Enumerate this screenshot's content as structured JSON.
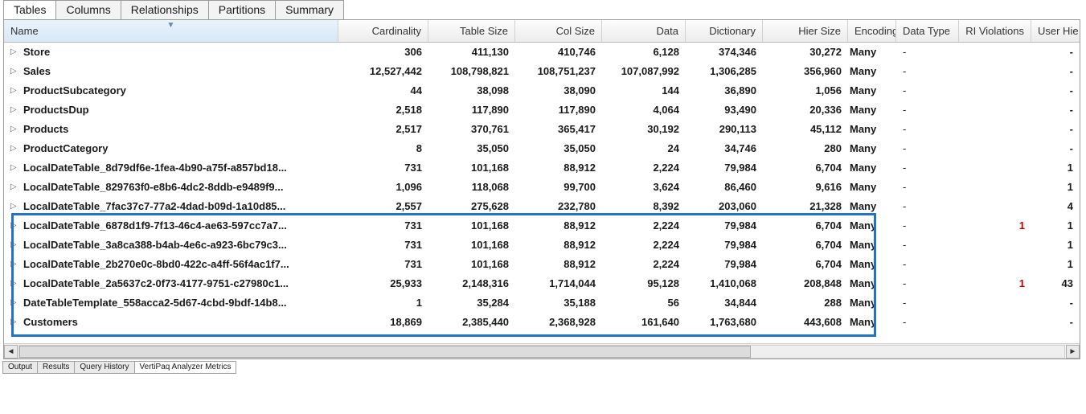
{
  "top_tabs": [
    "Tables",
    "Columns",
    "Relationships",
    "Partitions",
    "Summary"
  ],
  "top_tab_active": 0,
  "columns": {
    "name": "Name",
    "cardinality": "Cardinality",
    "table_size": "Table Size",
    "col_size": "Col Size",
    "data": "Data",
    "dictionary": "Dictionary",
    "hier_size": "Hier Size",
    "encoding": "Encoding",
    "data_type": "Data Type",
    "ri": "RI Violations",
    "user_hier": "User Hie"
  },
  "rows": [
    {
      "name": "Store",
      "card": "306",
      "tsize": "411,130",
      "csize": "410,746",
      "data": "6,128",
      "dict": "374,346",
      "hier": "30,272",
      "enc": "Many",
      "dt": "-",
      "ri": "",
      "uh": "-"
    },
    {
      "name": "Sales",
      "card": "12,527,442",
      "tsize": "108,798,821",
      "csize": "108,751,237",
      "data": "107,087,992",
      "dict": "1,306,285",
      "hier": "356,960",
      "enc": "Many",
      "dt": "-",
      "ri": "",
      "uh": "-"
    },
    {
      "name": "ProductSubcategory",
      "card": "44",
      "tsize": "38,098",
      "csize": "38,090",
      "data": "144",
      "dict": "36,890",
      "hier": "1,056",
      "enc": "Many",
      "dt": "-",
      "ri": "",
      "uh": "-"
    },
    {
      "name": "ProductsDup",
      "card": "2,518",
      "tsize": "117,890",
      "csize": "117,890",
      "data": "4,064",
      "dict": "93,490",
      "hier": "20,336",
      "enc": "Many",
      "dt": "-",
      "ri": "",
      "uh": "-"
    },
    {
      "name": "Products",
      "card": "2,517",
      "tsize": "370,761",
      "csize": "365,417",
      "data": "30,192",
      "dict": "290,113",
      "hier": "45,112",
      "enc": "Many",
      "dt": "-",
      "ri": "",
      "uh": "-"
    },
    {
      "name": "ProductCategory",
      "card": "8",
      "tsize": "35,050",
      "csize": "35,050",
      "data": "24",
      "dict": "34,746",
      "hier": "280",
      "enc": "Many",
      "dt": "-",
      "ri": "",
      "uh": "-"
    },
    {
      "name": "LocalDateTable_8d79df6e-1fea-4b90-a75f-a857bd18...",
      "card": "731",
      "tsize": "101,168",
      "csize": "88,912",
      "data": "2,224",
      "dict": "79,984",
      "hier": "6,704",
      "enc": "Many",
      "dt": "-",
      "ri": "",
      "uh": "1",
      "hl": true
    },
    {
      "name": "LocalDateTable_829763f0-e8b6-4dc2-8ddb-e9489f9...",
      "card": "1,096",
      "tsize": "118,068",
      "csize": "99,700",
      "data": "3,624",
      "dict": "86,460",
      "hier": "9,616",
      "enc": "Many",
      "dt": "-",
      "ri": "",
      "uh": "1",
      "hl": true
    },
    {
      "name": "LocalDateTable_7fac37c7-77a2-4dad-b09d-1a10d85...",
      "card": "2,557",
      "tsize": "275,628",
      "csize": "232,780",
      "data": "8,392",
      "dict": "203,060",
      "hier": "21,328",
      "enc": "Many",
      "dt": "-",
      "ri": "",
      "uh": "4",
      "hl": true
    },
    {
      "name": "LocalDateTable_6878d1f9-7f13-46c4-ae63-597cc7a7...",
      "card": "731",
      "tsize": "101,168",
      "csize": "88,912",
      "data": "2,224",
      "dict": "79,984",
      "hier": "6,704",
      "enc": "Many",
      "dt": "-",
      "ri": "1",
      "ri_red": true,
      "uh": "1",
      "hl": true
    },
    {
      "name": "LocalDateTable_3a8ca388-b4ab-4e6c-a923-6bc79c3...",
      "card": "731",
      "tsize": "101,168",
      "csize": "88,912",
      "data": "2,224",
      "dict": "79,984",
      "hier": "6,704",
      "enc": "Many",
      "dt": "-",
      "ri": "",
      "uh": "1",
      "hl": true
    },
    {
      "name": "LocalDateTable_2b270e0c-8bd0-422c-a4ff-56f4ac1f7...",
      "card": "731",
      "tsize": "101,168",
      "csize": "88,912",
      "data": "2,224",
      "dict": "79,984",
      "hier": "6,704",
      "enc": "Many",
      "dt": "-",
      "ri": "",
      "uh": "1",
      "hl": true
    },
    {
      "name": "LocalDateTable_2a5637c2-0f73-4177-9751-c27980c1...",
      "card": "25,933",
      "tsize": "2,148,316",
      "csize": "1,714,044",
      "data": "95,128",
      "dict": "1,410,068",
      "hier": "208,848",
      "enc": "Many",
      "dt": "-",
      "ri": "1",
      "ri_red": true,
      "uh": "43"
    },
    {
      "name": "DateTableTemplate_558acca2-5d67-4cbd-9bdf-14b8...",
      "card": "1",
      "tsize": "35,284",
      "csize": "35,188",
      "data": "56",
      "dict": "34,844",
      "hier": "288",
      "enc": "Many",
      "dt": "-",
      "ri": "",
      "uh": "-"
    },
    {
      "name": "Customers",
      "card": "18,869",
      "tsize": "2,385,440",
      "csize": "2,368,928",
      "data": "161,640",
      "dict": "1,763,680",
      "hier": "443,608",
      "enc": "Many",
      "dt": "-",
      "ri": "",
      "uh": "-"
    }
  ],
  "bottom_tabs": [
    "Output",
    "Results",
    "Query History",
    "VertiPaq Analyzer Metrics"
  ],
  "bottom_tab_active": 3
}
